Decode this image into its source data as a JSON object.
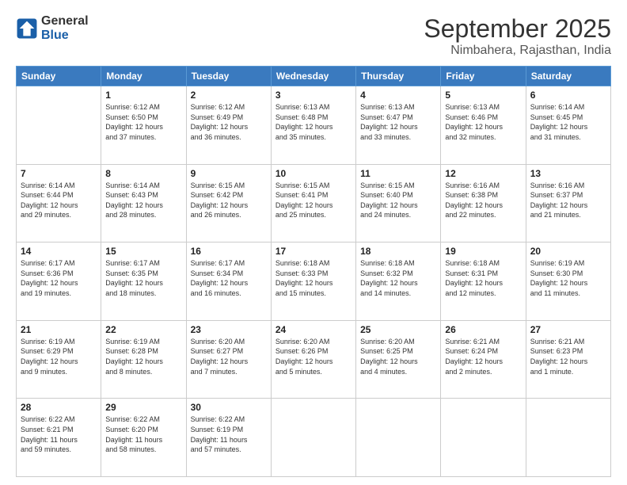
{
  "logo": {
    "line1": "General",
    "line2": "Blue"
  },
  "title": "September 2025",
  "subtitle": "Nimbahera, Rajasthan, India",
  "days_header": [
    "Sunday",
    "Monday",
    "Tuesday",
    "Wednesday",
    "Thursday",
    "Friday",
    "Saturday"
  ],
  "weeks": [
    [
      {
        "day": "",
        "info": ""
      },
      {
        "day": "1",
        "info": "Sunrise: 6:12 AM\nSunset: 6:50 PM\nDaylight: 12 hours\nand 37 minutes."
      },
      {
        "day": "2",
        "info": "Sunrise: 6:12 AM\nSunset: 6:49 PM\nDaylight: 12 hours\nand 36 minutes."
      },
      {
        "day": "3",
        "info": "Sunrise: 6:13 AM\nSunset: 6:48 PM\nDaylight: 12 hours\nand 35 minutes."
      },
      {
        "day": "4",
        "info": "Sunrise: 6:13 AM\nSunset: 6:47 PM\nDaylight: 12 hours\nand 33 minutes."
      },
      {
        "day": "5",
        "info": "Sunrise: 6:13 AM\nSunset: 6:46 PM\nDaylight: 12 hours\nand 32 minutes."
      },
      {
        "day": "6",
        "info": "Sunrise: 6:14 AM\nSunset: 6:45 PM\nDaylight: 12 hours\nand 31 minutes."
      }
    ],
    [
      {
        "day": "7",
        "info": "Sunrise: 6:14 AM\nSunset: 6:44 PM\nDaylight: 12 hours\nand 29 minutes."
      },
      {
        "day": "8",
        "info": "Sunrise: 6:14 AM\nSunset: 6:43 PM\nDaylight: 12 hours\nand 28 minutes."
      },
      {
        "day": "9",
        "info": "Sunrise: 6:15 AM\nSunset: 6:42 PM\nDaylight: 12 hours\nand 26 minutes."
      },
      {
        "day": "10",
        "info": "Sunrise: 6:15 AM\nSunset: 6:41 PM\nDaylight: 12 hours\nand 25 minutes."
      },
      {
        "day": "11",
        "info": "Sunrise: 6:15 AM\nSunset: 6:40 PM\nDaylight: 12 hours\nand 24 minutes."
      },
      {
        "day": "12",
        "info": "Sunrise: 6:16 AM\nSunset: 6:38 PM\nDaylight: 12 hours\nand 22 minutes."
      },
      {
        "day": "13",
        "info": "Sunrise: 6:16 AM\nSunset: 6:37 PM\nDaylight: 12 hours\nand 21 minutes."
      }
    ],
    [
      {
        "day": "14",
        "info": "Sunrise: 6:17 AM\nSunset: 6:36 PM\nDaylight: 12 hours\nand 19 minutes."
      },
      {
        "day": "15",
        "info": "Sunrise: 6:17 AM\nSunset: 6:35 PM\nDaylight: 12 hours\nand 18 minutes."
      },
      {
        "day": "16",
        "info": "Sunrise: 6:17 AM\nSunset: 6:34 PM\nDaylight: 12 hours\nand 16 minutes."
      },
      {
        "day": "17",
        "info": "Sunrise: 6:18 AM\nSunset: 6:33 PM\nDaylight: 12 hours\nand 15 minutes."
      },
      {
        "day": "18",
        "info": "Sunrise: 6:18 AM\nSunset: 6:32 PM\nDaylight: 12 hours\nand 14 minutes."
      },
      {
        "day": "19",
        "info": "Sunrise: 6:18 AM\nSunset: 6:31 PM\nDaylight: 12 hours\nand 12 minutes."
      },
      {
        "day": "20",
        "info": "Sunrise: 6:19 AM\nSunset: 6:30 PM\nDaylight: 12 hours\nand 11 minutes."
      }
    ],
    [
      {
        "day": "21",
        "info": "Sunrise: 6:19 AM\nSunset: 6:29 PM\nDaylight: 12 hours\nand 9 minutes."
      },
      {
        "day": "22",
        "info": "Sunrise: 6:19 AM\nSunset: 6:28 PM\nDaylight: 12 hours\nand 8 minutes."
      },
      {
        "day": "23",
        "info": "Sunrise: 6:20 AM\nSunset: 6:27 PM\nDaylight: 12 hours\nand 7 minutes."
      },
      {
        "day": "24",
        "info": "Sunrise: 6:20 AM\nSunset: 6:26 PM\nDaylight: 12 hours\nand 5 minutes."
      },
      {
        "day": "25",
        "info": "Sunrise: 6:20 AM\nSunset: 6:25 PM\nDaylight: 12 hours\nand 4 minutes."
      },
      {
        "day": "26",
        "info": "Sunrise: 6:21 AM\nSunset: 6:24 PM\nDaylight: 12 hours\nand 2 minutes."
      },
      {
        "day": "27",
        "info": "Sunrise: 6:21 AM\nSunset: 6:23 PM\nDaylight: 12 hours\nand 1 minute."
      }
    ],
    [
      {
        "day": "28",
        "info": "Sunrise: 6:22 AM\nSunset: 6:21 PM\nDaylight: 11 hours\nand 59 minutes."
      },
      {
        "day": "29",
        "info": "Sunrise: 6:22 AM\nSunset: 6:20 PM\nDaylight: 11 hours\nand 58 minutes."
      },
      {
        "day": "30",
        "info": "Sunrise: 6:22 AM\nSunset: 6:19 PM\nDaylight: 11 hours\nand 57 minutes."
      },
      {
        "day": "",
        "info": ""
      },
      {
        "day": "",
        "info": ""
      },
      {
        "day": "",
        "info": ""
      },
      {
        "day": "",
        "info": ""
      }
    ]
  ]
}
